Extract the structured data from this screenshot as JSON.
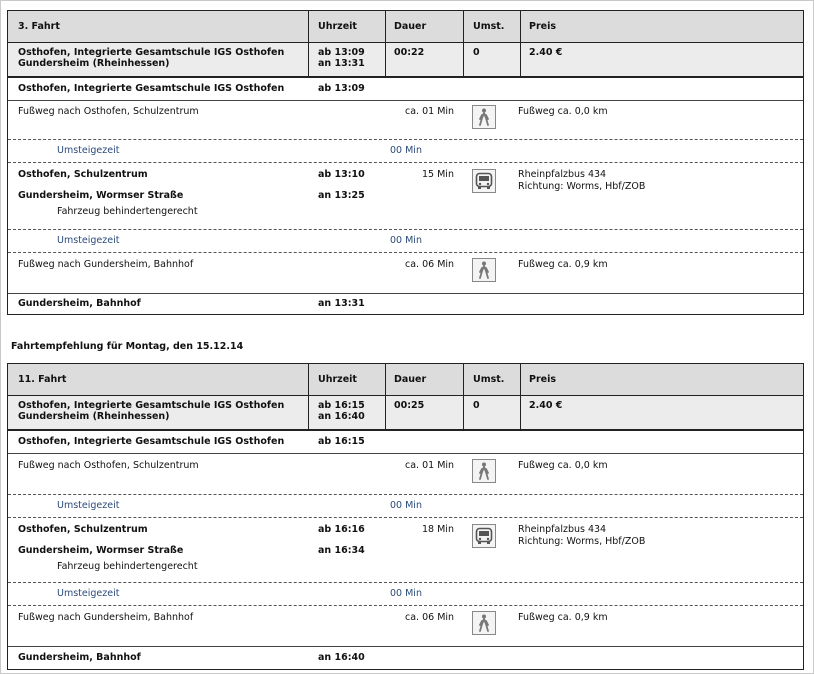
{
  "trip1": {
    "header": {
      "name": "3. Fahrt",
      "time": "Uhrzeit",
      "duration": "Dauer",
      "changes": "Umst.",
      "price": "Preis"
    },
    "summary": {
      "from": "Osthofen, Integrierte Gesamtschule IGS Osthofen",
      "to": "Gundersheim (Rheinhessen)",
      "dep": "ab 13:09",
      "arr": "an 13:31",
      "duration": "00:22",
      "changes": "0",
      "price": "2.40 €"
    },
    "start_stop": "Osthofen, Integrierte Gesamtschule IGS Osthofen",
    "start_time": "ab 13:09",
    "walk1": {
      "text": "Fußweg nach Osthofen, Schulzentrum",
      "duration": "ca. 01 Min",
      "info": "Fußweg ca. 0,0 km"
    },
    "transfer1": {
      "label": "Umsteigezeit",
      "duration": "00 Min"
    },
    "bus": {
      "from": "Osthofen, Schulzentrum",
      "dep": "ab 13:10",
      "duration": "15 Min",
      "line": "Rheinpfalzbus 434",
      "direction": "Richtung: Worms, Hbf/ZOB",
      "to": "Gundersheim, Wormser Straße",
      "arr": "an 13:25",
      "note": "Fahrzeug behindertengerecht"
    },
    "transfer2": {
      "label": "Umsteigezeit",
      "duration": "00 Min"
    },
    "walk2": {
      "text": "Fußweg nach Gundersheim, Bahnhof",
      "duration": "ca. 06 Min",
      "info": "Fußweg ca. 0,9 km"
    },
    "end_stop": "Gundersheim, Bahnhof",
    "end_time": "an 13:31"
  },
  "recommendation": "Fahrtempfehlung für Montag, den 15.12.14",
  "trip2": {
    "header": {
      "name": "11. Fahrt",
      "time": "Uhrzeit",
      "duration": "Dauer",
      "changes": "Umst.",
      "price": "Preis"
    },
    "summary": {
      "from": "Osthofen, Integrierte Gesamtschule IGS Osthofen",
      "to": "Gundersheim (Rheinhessen)",
      "dep": "ab 16:15",
      "arr": "an 16:40",
      "duration": "00:25",
      "changes": "0",
      "price": "2.40 €"
    },
    "start_stop": "Osthofen, Integrierte Gesamtschule IGS Osthofen",
    "start_time": "ab 16:15",
    "walk1": {
      "text": "Fußweg nach Osthofen, Schulzentrum",
      "duration": "ca. 01 Min",
      "info": "Fußweg ca. 0,0 km"
    },
    "transfer1": {
      "label": "Umsteigezeit",
      "duration": "00 Min"
    },
    "bus": {
      "from": "Osthofen, Schulzentrum",
      "dep": "ab 16:16",
      "duration": "18 Min",
      "line": "Rheinpfalzbus 434",
      "direction": "Richtung: Worms, Hbf/ZOB",
      "to": "Gundersheim, Wormser Straße",
      "arr": "an 16:34",
      "note": "Fahrzeug behindertengerecht"
    },
    "transfer2": {
      "label": "Umsteigezeit",
      "duration": "00 Min"
    },
    "walk2": {
      "text": "Fußweg nach Gundersheim, Bahnhof",
      "duration": "ca. 06 Min",
      "info": "Fußweg ca. 0,9 km"
    },
    "end_stop": "Gundersheim, Bahnhof",
    "end_time": "an 16:40"
  },
  "icons": {
    "walk": "pedestrian-icon",
    "bus": "bus-icon"
  }
}
